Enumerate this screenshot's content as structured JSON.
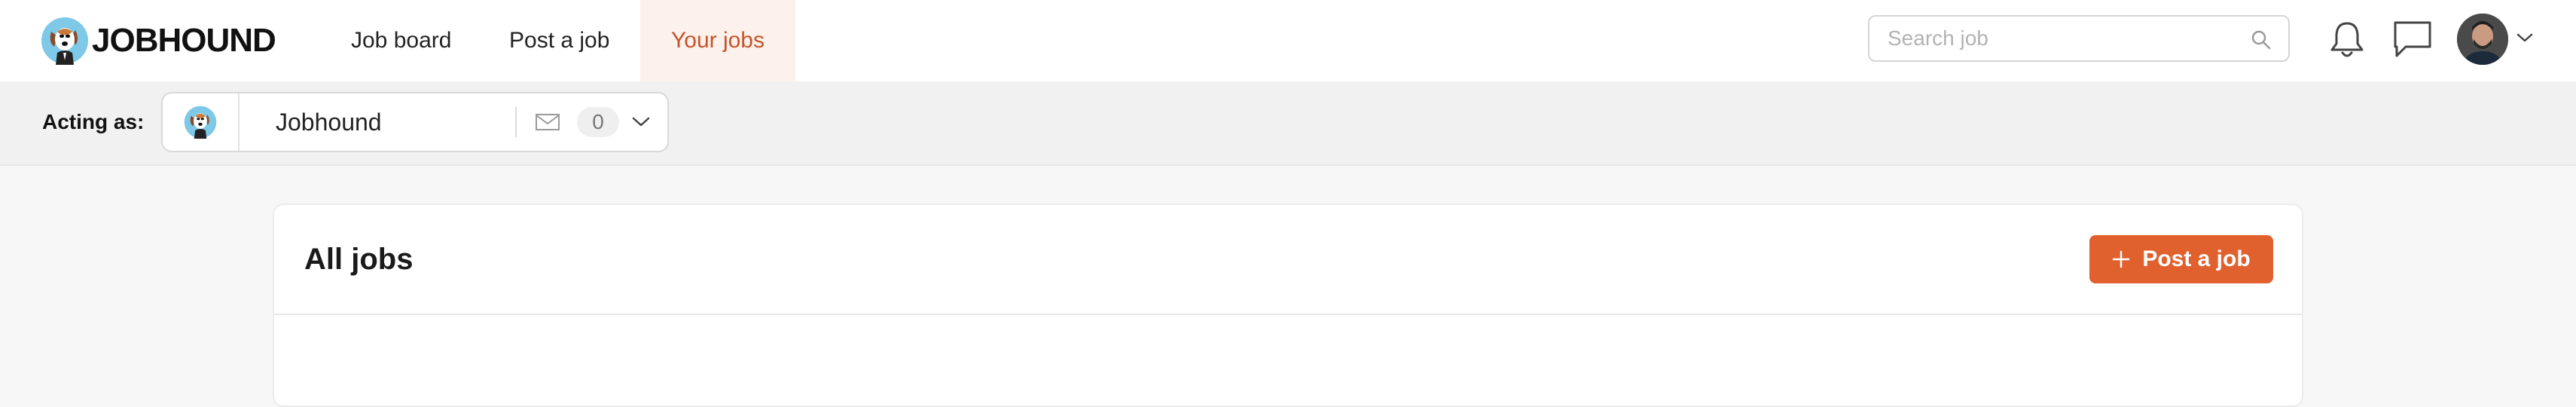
{
  "brand": {
    "name": "JOBHOUND"
  },
  "nav": {
    "items": [
      {
        "label": "Job board"
      },
      {
        "label": "Post a job"
      },
      {
        "label": "Your jobs",
        "active": true
      }
    ]
  },
  "search": {
    "placeholder": "Search job",
    "value": ""
  },
  "icons": {
    "search": "search-icon",
    "notifications": "bell-icon",
    "messages": "chat-icon",
    "account_menu": "chevron-down-icon",
    "mail": "mail-icon",
    "dropdown": "chevron-down-icon",
    "add": "plus-icon"
  },
  "acting_as": {
    "label": "Acting as:",
    "selected": "Jobhound",
    "unread_count": "0"
  },
  "main": {
    "title": "All jobs",
    "post_button_label": "Post a job"
  },
  "colors": {
    "accent": "#e0602e",
    "active_nav_text": "#c5542a",
    "active_nav_bg": "#fdf1ec",
    "page_bg": "#f7f7f7",
    "bar_bg": "#f1f1f1"
  }
}
